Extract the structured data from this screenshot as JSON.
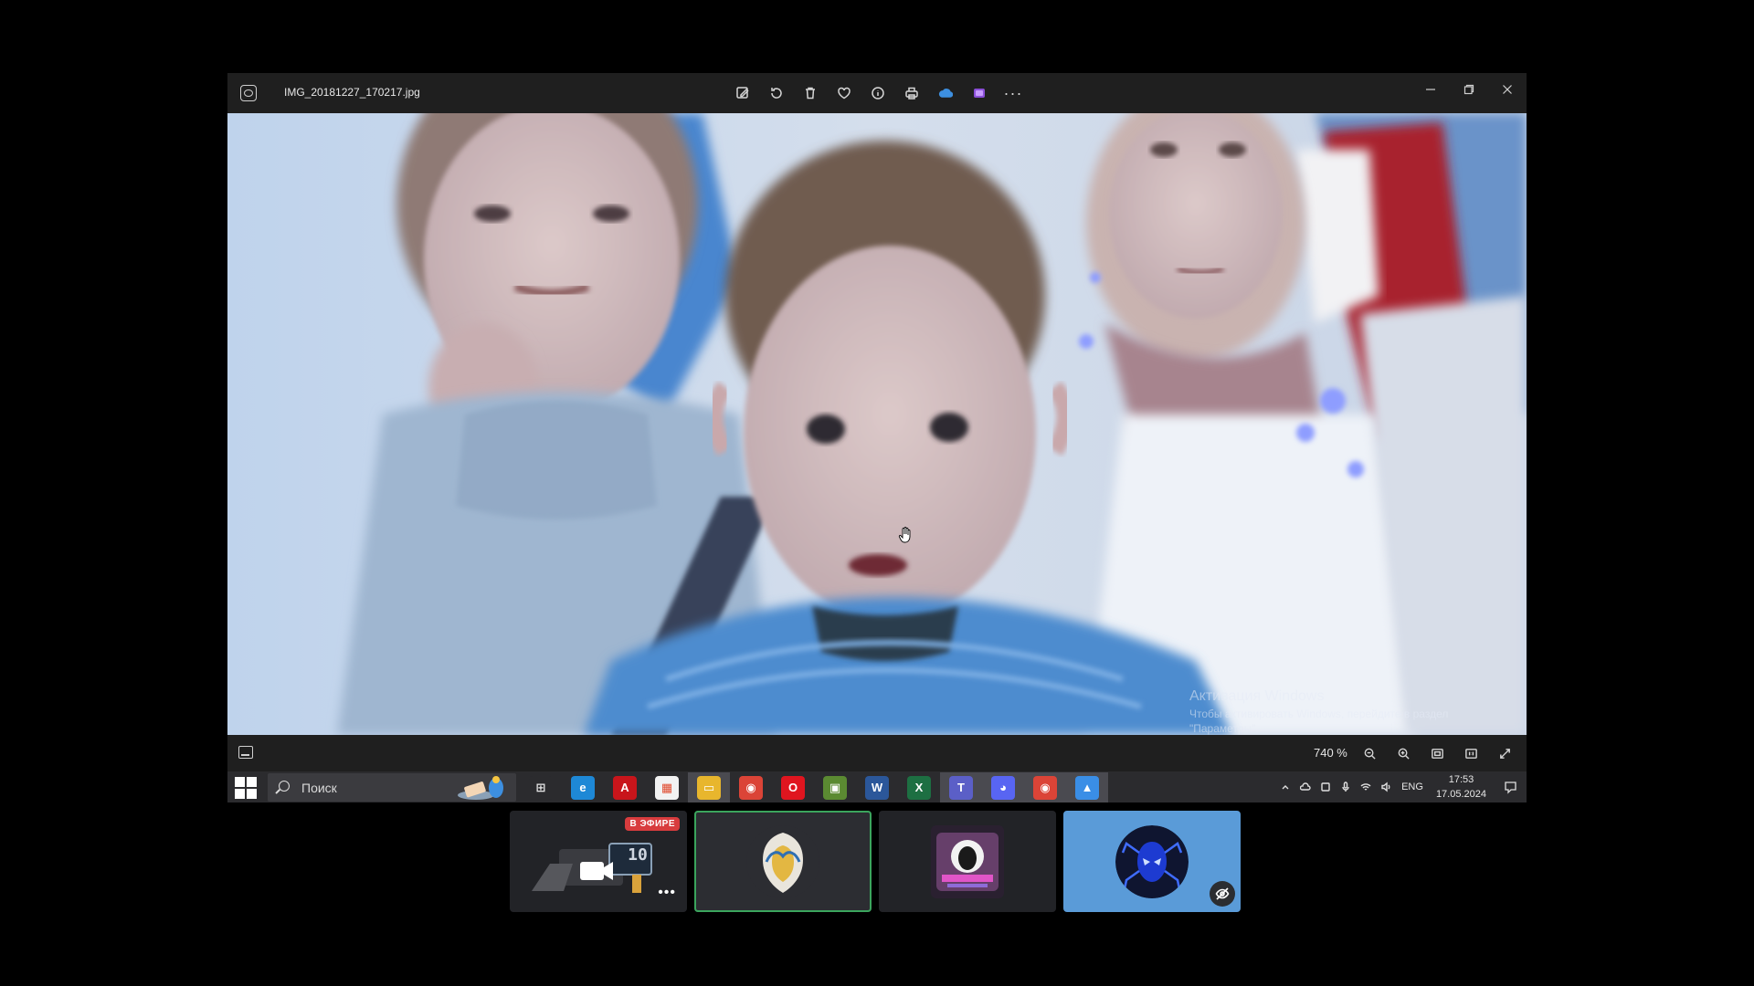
{
  "photos": {
    "file_name": "IMG_20181227_170217.jpg",
    "toolbar": [
      {
        "name": "edit-image-icon"
      },
      {
        "name": "rotate-icon"
      },
      {
        "name": "delete-icon"
      },
      {
        "name": "favorite-heart-icon"
      },
      {
        "name": "info-icon"
      },
      {
        "name": "print-icon"
      },
      {
        "name": "onedrive-icon"
      },
      {
        "name": "clipchamp-icon"
      },
      {
        "name": "more-options-icon"
      }
    ],
    "window_controls": [
      "minimize-icon",
      "restore-icon",
      "close-icon"
    ],
    "zoom_level": "740 %",
    "watermark": {
      "title": "Активация Windows",
      "line1": "Чтобы активировать Windows, перейдите в раздел",
      "line2": "\"Параметры\"."
    }
  },
  "taskbar": {
    "search_placeholder": "Поиск",
    "apps": [
      {
        "name": "task-view-icon",
        "color": "#2b2b2e",
        "glyph": "⊞",
        "active": false
      },
      {
        "name": "edge-icon",
        "color": "#1e88d6",
        "glyph": "e",
        "active": false
      },
      {
        "name": "acrobat-icon",
        "color": "#c8151b",
        "glyph": "A",
        "active": false
      },
      {
        "name": "ms-store-icon",
        "color": "#f2f2f2",
        "glyph": "▦",
        "active": false
      },
      {
        "name": "file-explorer-icon",
        "color": "#e8b62d",
        "glyph": "▭",
        "active": true
      },
      {
        "name": "chrome-icon",
        "color": "#db4437",
        "glyph": "◉",
        "active": false
      },
      {
        "name": "opera-icon",
        "color": "#e0151f",
        "glyph": "O",
        "active": false
      },
      {
        "name": "minecraft-icon",
        "color": "#5b8a32",
        "glyph": "▣",
        "active": false
      },
      {
        "name": "word-icon",
        "color": "#2b579a",
        "glyph": "W",
        "active": false
      },
      {
        "name": "excel-icon",
        "color": "#1d6f42",
        "glyph": "X",
        "active": false
      },
      {
        "name": "teams-icon",
        "color": "#5b5fc7",
        "glyph": "T",
        "active": true
      },
      {
        "name": "discord-icon",
        "color": "#5865f2",
        "glyph": "◕",
        "active": true
      },
      {
        "name": "chrome-profile-icon",
        "color": "#db4437",
        "glyph": "◉",
        "active": true
      },
      {
        "name": "photos-icon",
        "color": "#3a8ee6",
        "glyph": "▲",
        "active": true
      }
    ],
    "language": "ENG",
    "time": "17:53",
    "date": "17.05.2024"
  },
  "participants": [
    {
      "name": "participant-tile-streaming",
      "live_label": "В ЭФИРЕ",
      "stream_number": "10"
    },
    {
      "name": "participant-tile-shield-avatar"
    },
    {
      "name": "participant-tile-hacker-avatar"
    },
    {
      "name": "participant-tile-spider-avatar"
    }
  ],
  "colors": {
    "accent_speaking": "#3ba55d",
    "live_red": "#d83c3e",
    "tile_blue": "#5a9bd8"
  }
}
